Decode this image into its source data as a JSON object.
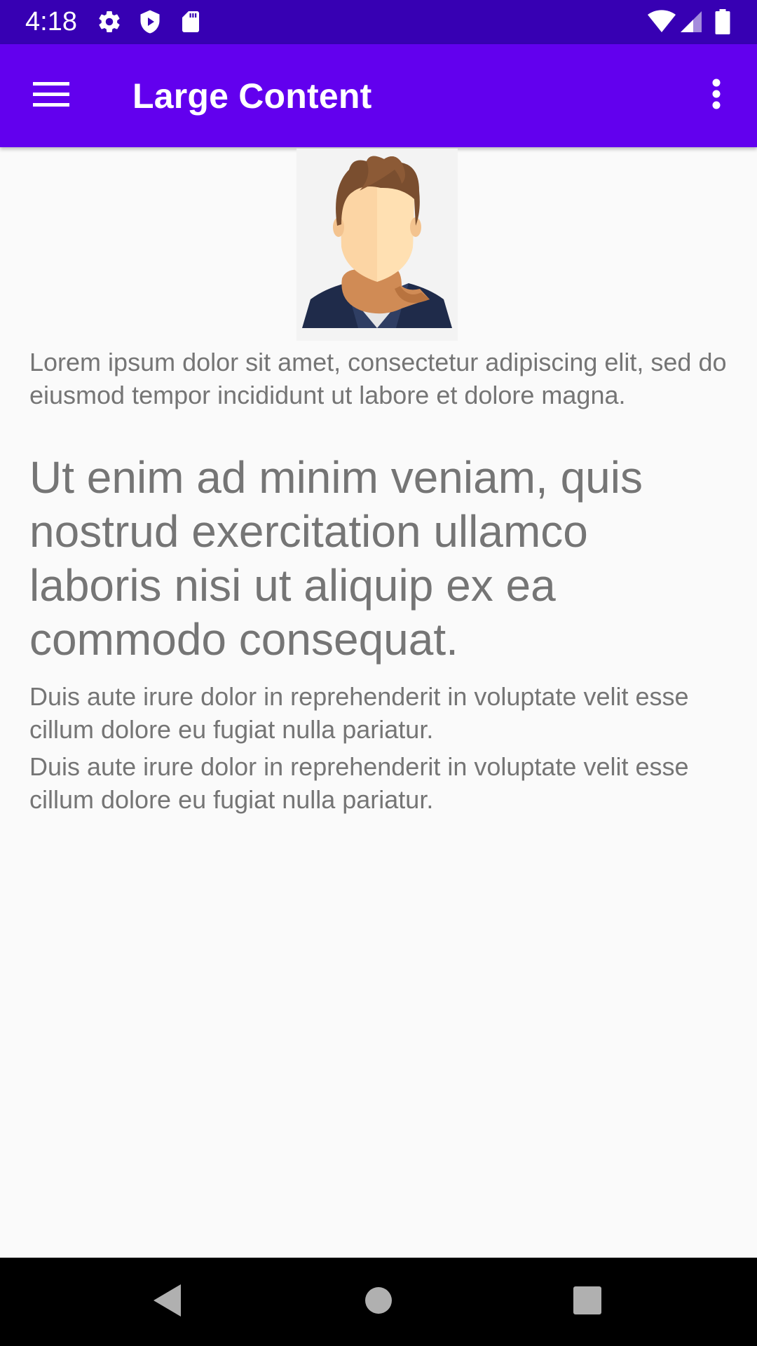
{
  "status_bar": {
    "time": "4:18",
    "left_icons": [
      "gear-icon",
      "shield-play-icon",
      "sd-card-icon"
    ],
    "right_icons": [
      "wifi-icon",
      "cell-signal-icon",
      "battery-icon"
    ]
  },
  "app_bar": {
    "title": "Large Content",
    "menu_icon": "hamburger-menu-icon",
    "overflow_icon": "more-vert-icon",
    "color": "#6200ee",
    "status_color": "#3700b3"
  },
  "content": {
    "avatar": "person-avatar-image",
    "paragraphs": [
      "Lorem ipsum dolor sit amet, consectetur adipiscing elit, sed do eiusmod tempor incididunt ut labore et dolore magna.",
      "Ut enim ad minim veniam, quis nostrud exercitation ullamco laboris nisi ut aliquip ex ea commodo consequat.",
      "Duis aute irure dolor in reprehenderit in voluptate velit esse cillum dolore eu fugiat nulla pariatur.",
      "Duis aute irure dolor in reprehenderit in voluptate velit esse cillum dolore eu fugiat nulla pariatur."
    ],
    "text_color": "#757575"
  },
  "nav_bar": {
    "back_icon": "back-triangle-icon",
    "home_icon": "home-circle-icon",
    "recents_icon": "recents-square-icon"
  }
}
